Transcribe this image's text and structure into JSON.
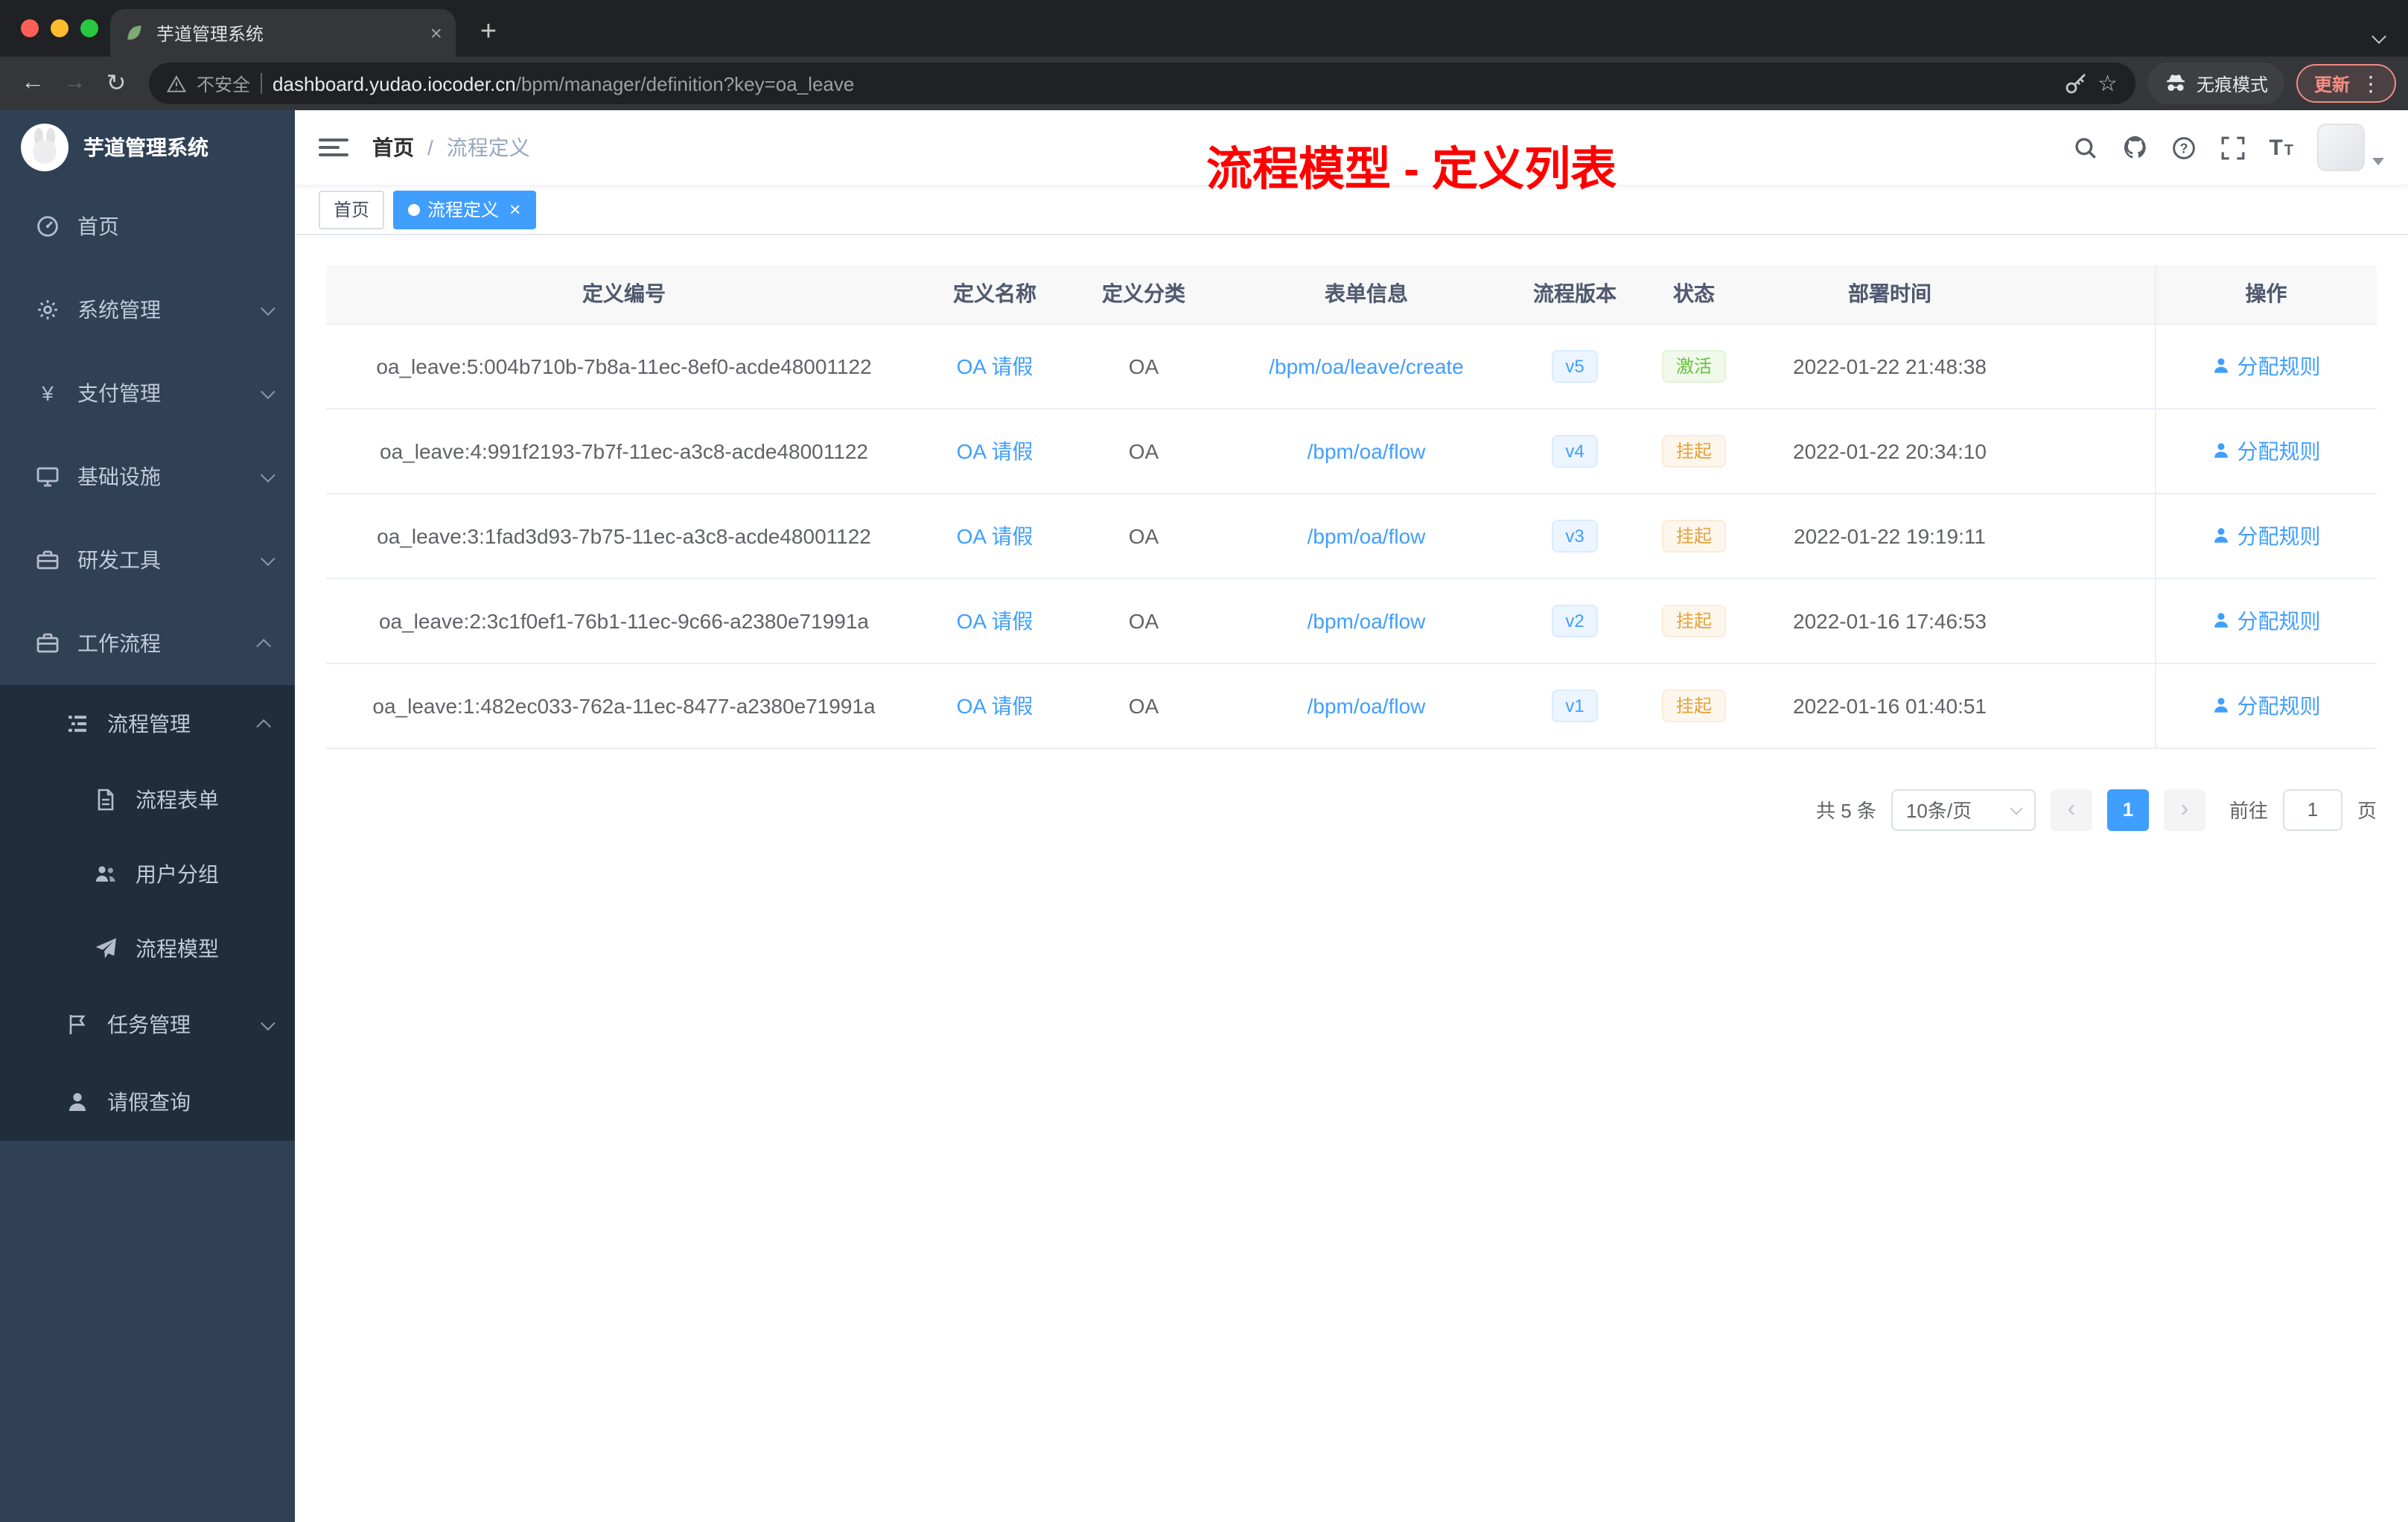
{
  "browser": {
    "tab_title": "芋道管理系统",
    "new_tab": "+",
    "security_label": "不安全",
    "url_domain": "dashboard.yudao.iocoder.cn",
    "url_path": "/bpm/manager/definition?key=oa_leave",
    "incognito_label": "无痕模式",
    "update_label": "更新"
  },
  "sidebar": {
    "logo_title": "芋道管理系统",
    "menu": [
      {
        "label": "首页"
      },
      {
        "label": "系统管理"
      },
      {
        "label": "支付管理"
      },
      {
        "label": "基础设施"
      },
      {
        "label": "研发工具"
      },
      {
        "label": "工作流程"
      }
    ],
    "submenu": {
      "process": {
        "label": "流程管理",
        "children": [
          {
            "label": "流程表单"
          },
          {
            "label": "用户分组"
          },
          {
            "label": "流程模型"
          }
        ]
      },
      "task": {
        "label": "任务管理"
      },
      "leave": {
        "label": "请假查询"
      }
    }
  },
  "header": {
    "breadcrumb_home": "首页",
    "breadcrumb_separator": "/",
    "breadcrumb_current": "流程定义"
  },
  "annotation": {
    "title": "流程模型 - 定义列表",
    "color": "#ff0000"
  },
  "tags": [
    {
      "label": "首页",
      "active": false
    },
    {
      "label": "流程定义",
      "active": true
    }
  ],
  "table": {
    "columns": [
      "定义编号",
      "定义名称",
      "定义分类",
      "表单信息",
      "流程版本",
      "状态",
      "部署时间",
      "操作"
    ],
    "rows": [
      {
        "id": "oa_leave:5:004b710b-7b8a-11ec-8ef0-acde48001122",
        "name": "OA 请假",
        "category": "OA",
        "form": "/bpm/oa/leave/create",
        "version": "v5",
        "status": "激活",
        "status_type": "success",
        "deploy_time": "2022-01-22 21:48:38",
        "action": "分配规则"
      },
      {
        "id": "oa_leave:4:991f2193-7b7f-11ec-a3c8-acde48001122",
        "name": "OA 请假",
        "category": "OA",
        "form": "/bpm/oa/flow",
        "version": "v4",
        "status": "挂起",
        "status_type": "warning",
        "deploy_time": "2022-01-22 20:34:10",
        "action": "分配规则"
      },
      {
        "id": "oa_leave:3:1fad3d93-7b75-11ec-a3c8-acde48001122",
        "name": "OA 请假",
        "category": "OA",
        "form": "/bpm/oa/flow",
        "version": "v3",
        "status": "挂起",
        "status_type": "warning",
        "deploy_time": "2022-01-22 19:19:11",
        "action": "分配规则"
      },
      {
        "id": "oa_leave:2:3c1f0ef1-76b1-11ec-9c66-a2380e71991a",
        "name": "OA 请假",
        "category": "OA",
        "form": "/bpm/oa/flow",
        "version": "v2",
        "status": "挂起",
        "status_type": "warning",
        "deploy_time": "2022-01-16 17:46:53",
        "action": "分配规则"
      },
      {
        "id": "oa_leave:1:482ec033-762a-11ec-8477-a2380e71991a",
        "name": "OA 请假",
        "category": "OA",
        "form": "/bpm/oa/flow",
        "version": "v1",
        "status": "挂起",
        "status_type": "warning",
        "deploy_time": "2022-01-16 01:40:51",
        "action": "分配规则"
      }
    ]
  },
  "pagination": {
    "total": "共 5 条",
    "page_size": "10条/页",
    "page": "1",
    "goto_label": "前往",
    "goto_value": "1",
    "goto_unit": "页"
  },
  "colors": {
    "accent": "#409eff",
    "success": "#67c23a",
    "warning": "#e6a23c",
    "annotation_red": "#ff0000",
    "sidebar_bg": "#304156",
    "submenu_bg": "#1f2d3d",
    "active_tag_bg": "#409eff"
  }
}
